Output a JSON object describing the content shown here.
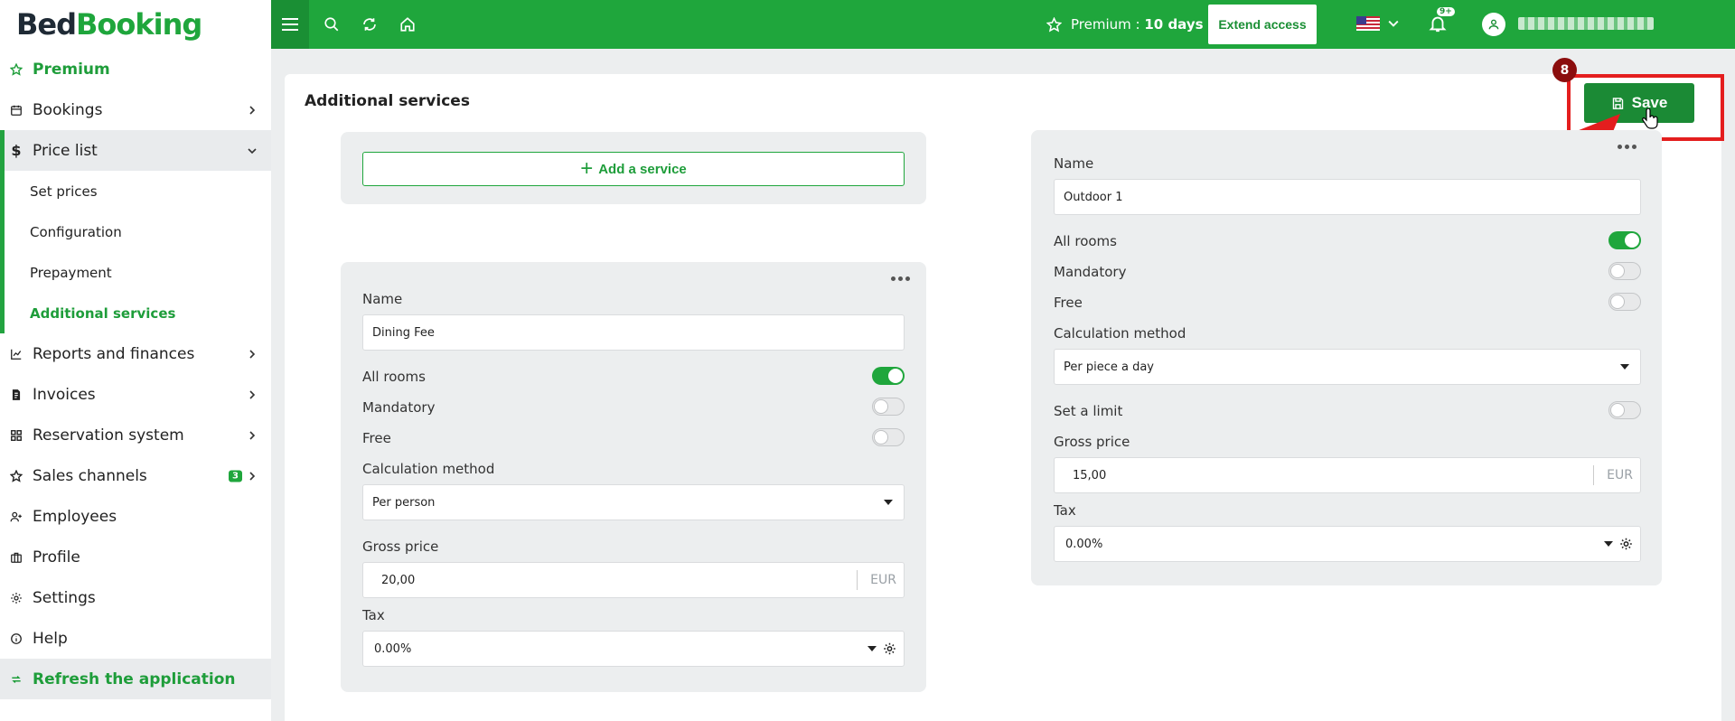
{
  "brand": {
    "part1": "Bed",
    "part2": "Booking",
    "accent": "#1fa63c"
  },
  "sidebar": {
    "items": [
      {
        "label": "Premium",
        "icon": "star-icon"
      },
      {
        "label": "Bookings",
        "icon": "calendar-icon"
      },
      {
        "label": "Price list",
        "icon": "dollar-icon"
      },
      {
        "label": "Set prices"
      },
      {
        "label": "Configuration"
      },
      {
        "label": "Prepayment"
      },
      {
        "label": "Additional services"
      },
      {
        "label": "Reports and finances",
        "icon": "chart-icon"
      },
      {
        "label": "Invoices",
        "icon": "invoice-icon"
      },
      {
        "label": "Reservation system",
        "icon": "grid-icon"
      },
      {
        "label": "Sales channels",
        "icon": "star-icon",
        "badge": "3"
      },
      {
        "label": "Employees",
        "icon": "user-plus-icon"
      },
      {
        "label": "Profile",
        "icon": "briefcase-icon"
      },
      {
        "label": "Settings",
        "icon": "gear-icon"
      },
      {
        "label": "Help",
        "icon": "info-icon"
      },
      {
        "label": "Refresh the application",
        "icon": "refresh-icon"
      }
    ]
  },
  "topbar": {
    "premium_label": "Premium : ",
    "premium_days": "10 days",
    "extend_label": "Extend access",
    "notifications": "9+"
  },
  "main": {
    "title": "Additional services",
    "save_label": "Save",
    "step": "8",
    "add_service_label": "Add a service",
    "services": [
      {
        "name_label": "Name",
        "name_value": "Dining Fee",
        "all_rooms": "All rooms",
        "mandatory": "Mandatory",
        "free": "Free",
        "calc_label": "Calculation method",
        "calc_value": "Per person",
        "price_label": "Gross price",
        "price_value": "20,00",
        "currency": "EUR",
        "tax_label": "Tax",
        "tax_value": "0.00%"
      },
      {
        "name_label": "Name",
        "name_value": "Outdoor 1",
        "all_rooms": "All rooms",
        "mandatory": "Mandatory",
        "free": "Free",
        "calc_label": "Calculation method",
        "calc_value": "Per piece a day",
        "limit_label": "Set a limit",
        "price_label": "Gross price",
        "price_value": "15,00",
        "currency": "EUR",
        "tax_label": "Tax",
        "tax_value": "0.00%"
      }
    ]
  }
}
